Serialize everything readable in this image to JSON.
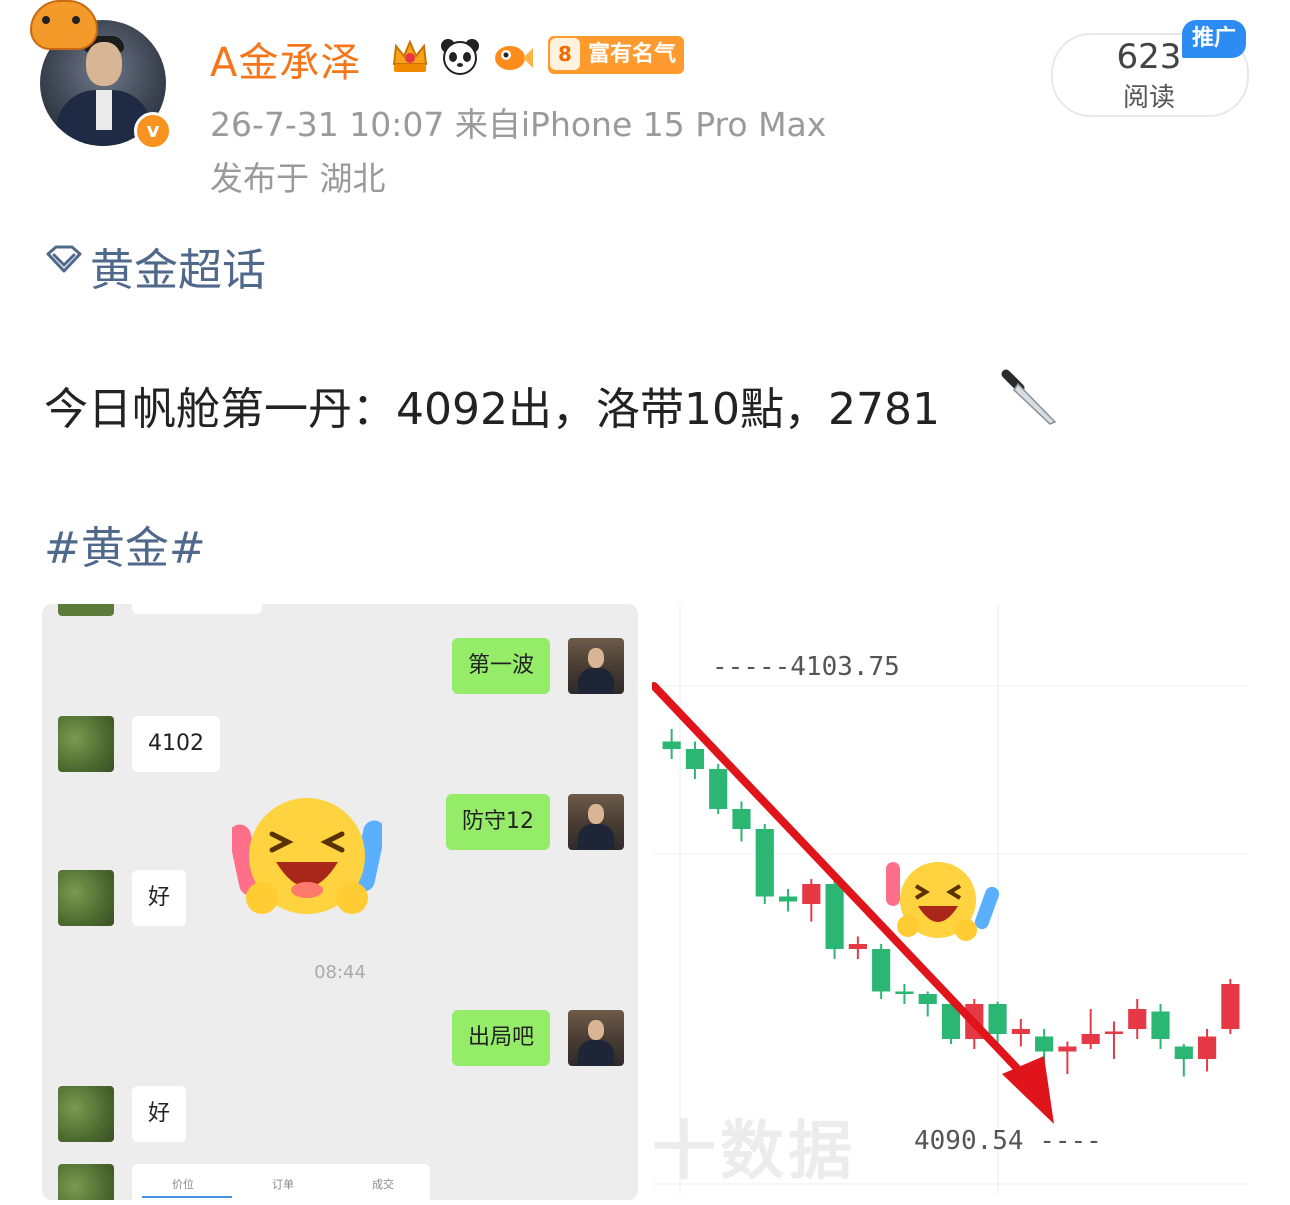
{
  "header": {
    "username": "A金承泽",
    "badges": [
      "crown-vip-badge",
      "panda-badge",
      "goldfish-badge"
    ],
    "fame_level": "8",
    "fame_label": "富有名气",
    "meta": "26-7-31 10:07  来自iPhone 15 Pro Max",
    "location": "发布于 湖北",
    "reads_count": "623",
    "reads_label": "阅读",
    "promo_label": "推广"
  },
  "post": {
    "topic": "黄金超话",
    "text": "今日帆舱第一丹：4092出，洛带10點，2781",
    "hashtag": "#黄金#"
  },
  "chat_image": {
    "messages": [
      {
        "side": "right",
        "text": "第一波"
      },
      {
        "side": "left",
        "text": "4102"
      },
      {
        "side": "right",
        "text": "防守12"
      },
      {
        "side": "left",
        "text": "好"
      },
      {
        "side": "right",
        "text": "出局吧"
      },
      {
        "side": "left",
        "text": "好"
      }
    ],
    "time": "08:44",
    "order_tabs": [
      "价位",
      "订单",
      "成交"
    ]
  },
  "kline_image": {
    "price_high": "-----4103.75",
    "price_low": "4090.54 ----",
    "watermark": "十数据"
  },
  "chart_data": {
    "type": "candlestick",
    "title": "",
    "ylim": [
      4088,
      4106
    ],
    "annotations": [
      "4103.75",
      "4090.54"
    ],
    "candles": [
      {
        "o": 4103.3,
        "c": 4103.0,
        "h": 4103.8,
        "l": 4102.6,
        "dir": "down"
      },
      {
        "o": 4103.0,
        "c": 4102.2,
        "h": 4103.3,
        "l": 4101.8,
        "dir": "down"
      },
      {
        "o": 4102.2,
        "c": 4100.6,
        "h": 4102.4,
        "l": 4100.4,
        "dir": "down"
      },
      {
        "o": 4100.6,
        "c": 4099.8,
        "h": 4100.9,
        "l": 4099.3,
        "dir": "down"
      },
      {
        "o": 4099.8,
        "c": 4097.1,
        "h": 4100.0,
        "l": 4096.8,
        "dir": "down"
      },
      {
        "o": 4097.1,
        "c": 4096.9,
        "h": 4097.4,
        "l": 4096.5,
        "dir": "down"
      },
      {
        "o": 4096.8,
        "c": 4097.6,
        "h": 4097.8,
        "l": 4096.1,
        "dir": "up"
      },
      {
        "o": 4097.6,
        "c": 4095.0,
        "h": 4098.0,
        "l": 4094.6,
        "dir": "down"
      },
      {
        "o": 4095.0,
        "c": 4095.2,
        "h": 4095.5,
        "l": 4094.6,
        "dir": "up"
      },
      {
        "o": 4095.0,
        "c": 4093.3,
        "h": 4095.2,
        "l": 4093.0,
        "dir": "down"
      },
      {
        "o": 4093.3,
        "c": 4093.2,
        "h": 4093.6,
        "l": 4092.8,
        "dir": "down"
      },
      {
        "o": 4093.2,
        "c": 4092.8,
        "h": 4093.3,
        "l": 4092.3,
        "dir": "down"
      },
      {
        "o": 4092.8,
        "c": 4091.4,
        "h": 4093.0,
        "l": 4091.2,
        "dir": "down"
      },
      {
        "o": 4091.4,
        "c": 4092.8,
        "h": 4093.0,
        "l": 4091.0,
        "dir": "up"
      },
      {
        "o": 4092.8,
        "c": 4091.6,
        "h": 4092.9,
        "l": 4091.2,
        "dir": "down"
      },
      {
        "o": 4091.6,
        "c": 4091.8,
        "h": 4092.2,
        "l": 4091.1,
        "dir": "up"
      },
      {
        "o": 4091.5,
        "c": 4090.9,
        "h": 4091.8,
        "l": 4090.5,
        "dir": "down"
      },
      {
        "o": 4090.9,
        "c": 4091.1,
        "h": 4091.3,
        "l": 4090.0,
        "dir": "up"
      },
      {
        "o": 4091.2,
        "c": 4091.6,
        "h": 4092.6,
        "l": 4091.0,
        "dir": "up"
      },
      {
        "o": 4091.6,
        "c": 4091.7,
        "h": 4092.1,
        "l": 4090.6,
        "dir": "up"
      },
      {
        "o": 4091.8,
        "c": 4092.6,
        "h": 4093.0,
        "l": 4091.4,
        "dir": "up"
      },
      {
        "o": 4092.5,
        "c": 4091.4,
        "h": 4092.8,
        "l": 4091.0,
        "dir": "down"
      },
      {
        "o": 4091.1,
        "c": 4090.6,
        "h": 4091.2,
        "l": 4089.9,
        "dir": "down"
      },
      {
        "o": 4090.6,
        "c": 4091.5,
        "h": 4091.8,
        "l": 4090.1,
        "dir": "up"
      },
      {
        "o": 4091.8,
        "c": 4093.6,
        "h": 4093.8,
        "l": 4091.6,
        "dir": "up"
      }
    ],
    "colors": {
      "up": "#e63946",
      "down": "#2bb673",
      "arrow": "#e0141b"
    }
  }
}
